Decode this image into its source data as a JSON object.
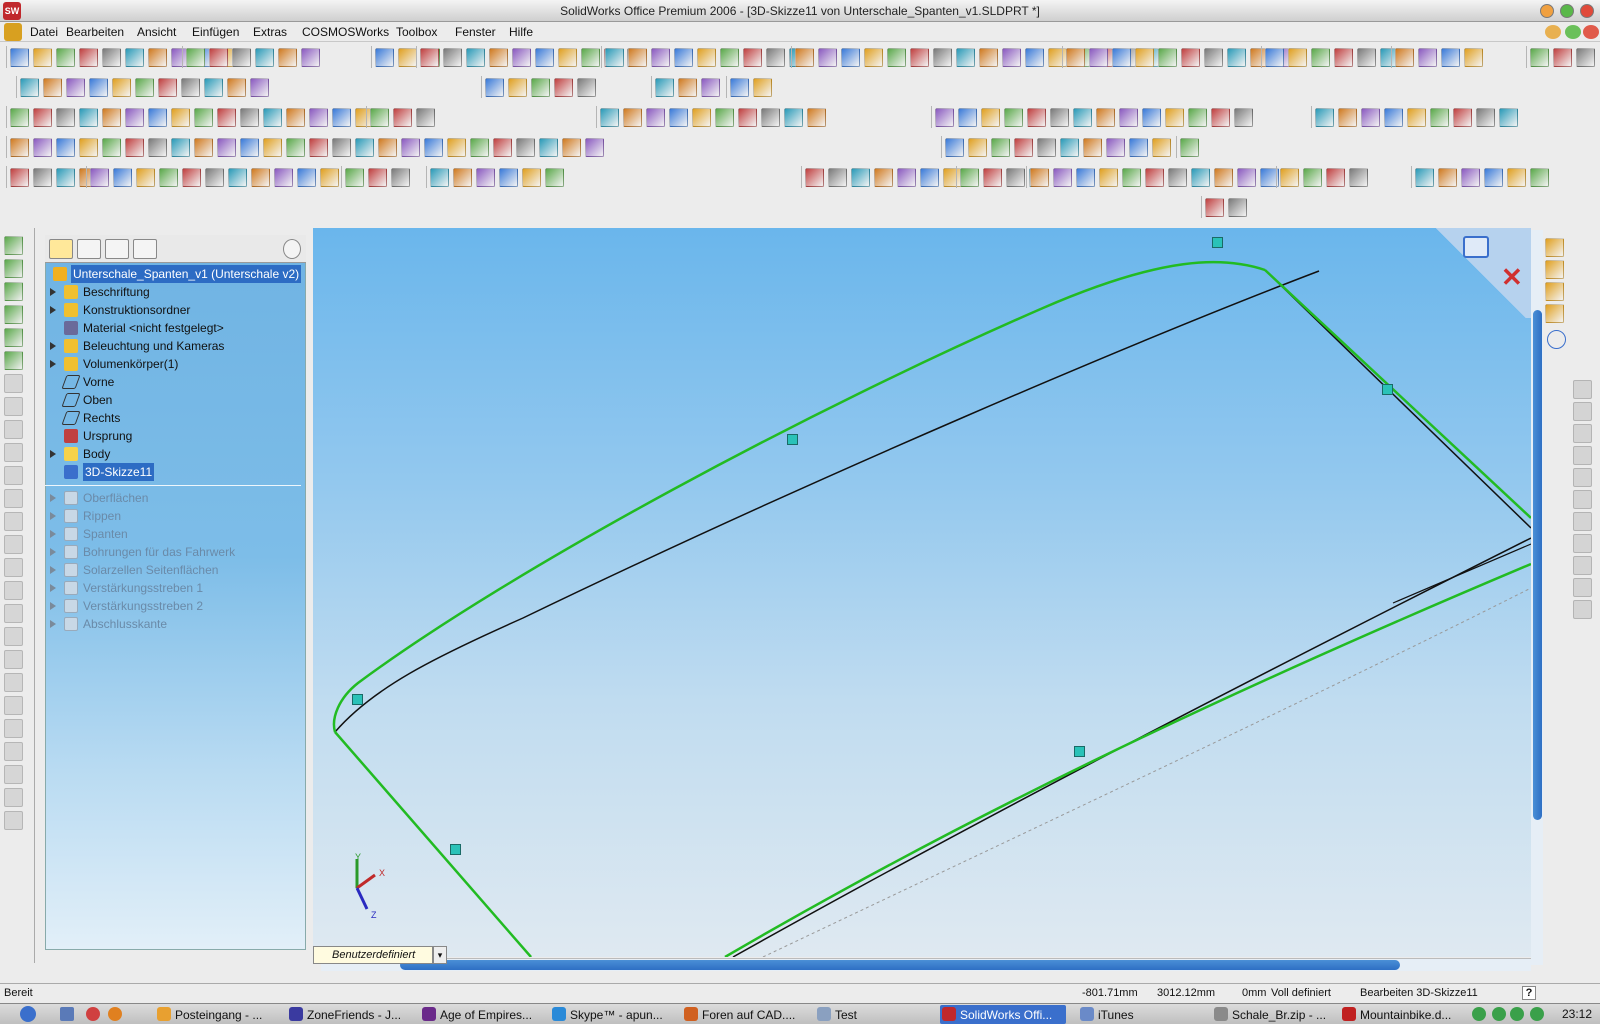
{
  "window": {
    "title": "SolidWorks Office Premium 2006 - [3D-Skizze11 von Unterschale_Spanten_v1.SLDPRT *]"
  },
  "app_icon": {
    "label": "SW"
  },
  "menu": [
    "Datei",
    "Bearbeiten",
    "Ansicht",
    "Einfügen",
    "Extras",
    "COSMOSWorks",
    "Toolbox",
    "Fenster",
    "Hilfe"
  ],
  "tree": {
    "root": "Unterschale_Spanten_v1  (Unterschale v2)",
    "items": [
      {
        "label": "Beschriftung",
        "icon": "annotation-icon"
      },
      {
        "label": "Konstruktionsordner",
        "icon": "design-binder-icon"
      },
      {
        "label": "Material <nicht festgelegt>",
        "icon": "material-icon"
      },
      {
        "label": "Beleuchtung und Kameras",
        "icon": "lights-cameras-icon"
      },
      {
        "label": "Volumenkörper(1)",
        "icon": "solid-body-icon"
      },
      {
        "label": "Vorne",
        "icon": "plane-icon"
      },
      {
        "label": "Oben",
        "icon": "plane-icon"
      },
      {
        "label": "Rechts",
        "icon": "plane-icon"
      },
      {
        "label": "Ursprung",
        "icon": "origin-icon"
      },
      {
        "label": "Body",
        "icon": "folder-icon"
      },
      {
        "label": "3D-Skizze11",
        "icon": "3d-sketch-icon"
      }
    ],
    "suppressed": [
      "Oberflächen",
      "Rippen",
      "Spanten",
      "Bohrungen für das Fahrwerk",
      "Solarzellen Seitenflächen",
      "Verstärkungsstreben 1",
      "Verstärkungsstreben 2",
      "Abschlusskante"
    ]
  },
  "view": {
    "orientation": "Benutzerdefiniert",
    "caret": "▾"
  },
  "triad": {
    "x": "X",
    "y": "Y",
    "z": "Z"
  },
  "status": {
    "left": "Bereit",
    "x": "-801.71mm",
    "y": "3012.12mm",
    "z": "0mm",
    "state": "Voll definiert",
    "edit": "Bearbeiten 3D-Skizze11",
    "help": "?"
  },
  "taskbar": [
    {
      "label": "Posteingang - ...",
      "color": "#e8a030"
    },
    {
      "label": "ZoneFriends - J...",
      "color": "#3a3aa0"
    },
    {
      "label": "Age of Empires...",
      "color": "#6a2a8a"
    },
    {
      "label": "Skype™ - apun...",
      "color": "#2a8ad8"
    },
    {
      "label": "Foren auf CAD....",
      "color": "#d06020"
    },
    {
      "label": "Test",
      "color": "#8aa0c0"
    },
    {
      "label": "SolidWorks Offi...",
      "color": "#c0282c"
    },
    {
      "label": "iTunes",
      "color": "#6a8ac8"
    },
    {
      "label": "Schale_Br.zip - ...",
      "color": "#8a8a8a"
    },
    {
      "label": "Mountainbike.d...",
      "color": "#c02020"
    }
  ],
  "clock": "23:12",
  "colors": {
    "sketch_green": "#22bb22",
    "edge_black": "#111111",
    "selection_blue": "#2d6cc4"
  }
}
